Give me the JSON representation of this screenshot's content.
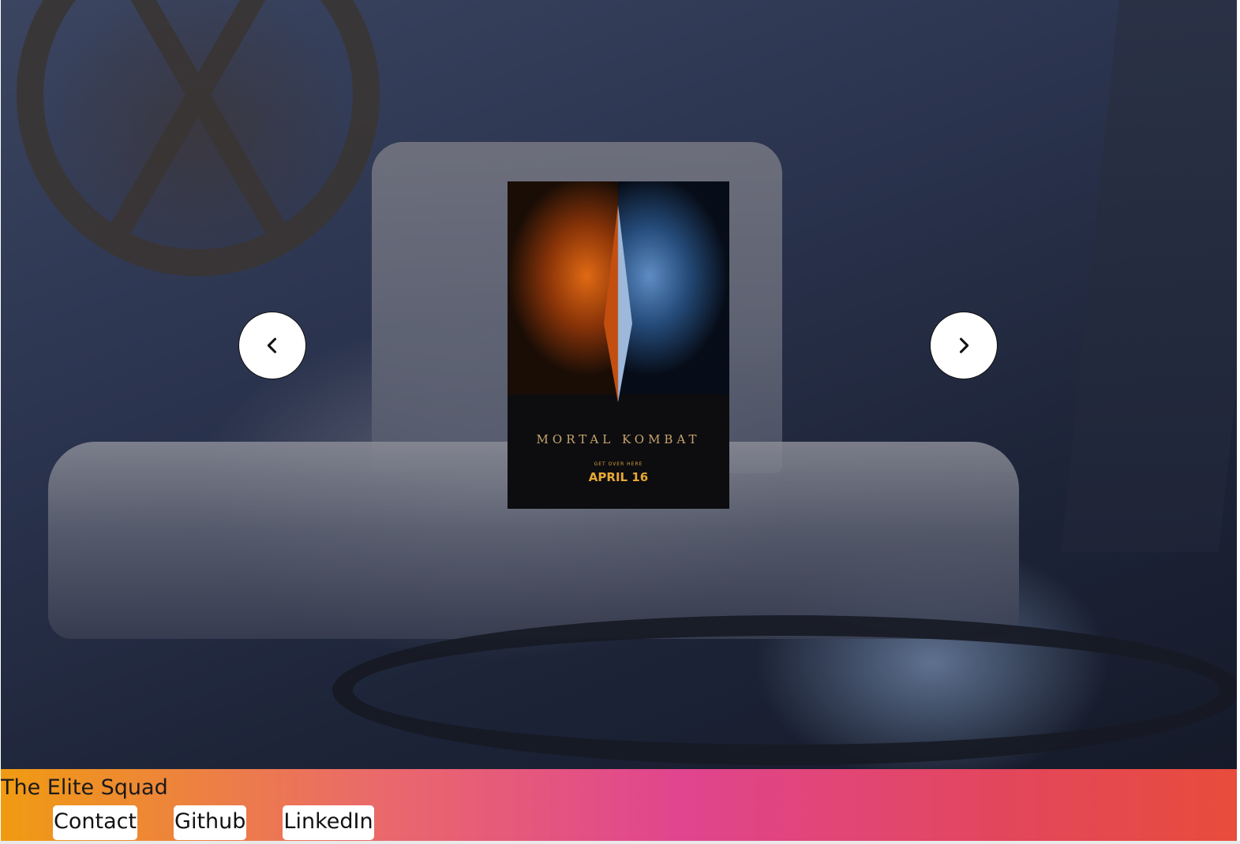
{
  "carousel": {
    "background_description_icon": "film-projector-photo",
    "poster": {
      "title": "MORTAL KOMBAT",
      "subtitle": "GET OVER HERE",
      "date": "APRIL 16"
    },
    "prev_icon": "chevron-left-icon",
    "next_icon": "chevron-right-icon"
  },
  "footer": {
    "brand": "The Elite Squad",
    "links": [
      {
        "label": "Contact"
      },
      {
        "label": "Github"
      },
      {
        "label": "LinkedIn"
      }
    ]
  },
  "colors": {
    "footer_gradient_start": "#f09b12",
    "footer_gradient_mid": "#e0458f",
    "footer_gradient_end": "#e84c3b",
    "button_bg": "#ffffff"
  }
}
